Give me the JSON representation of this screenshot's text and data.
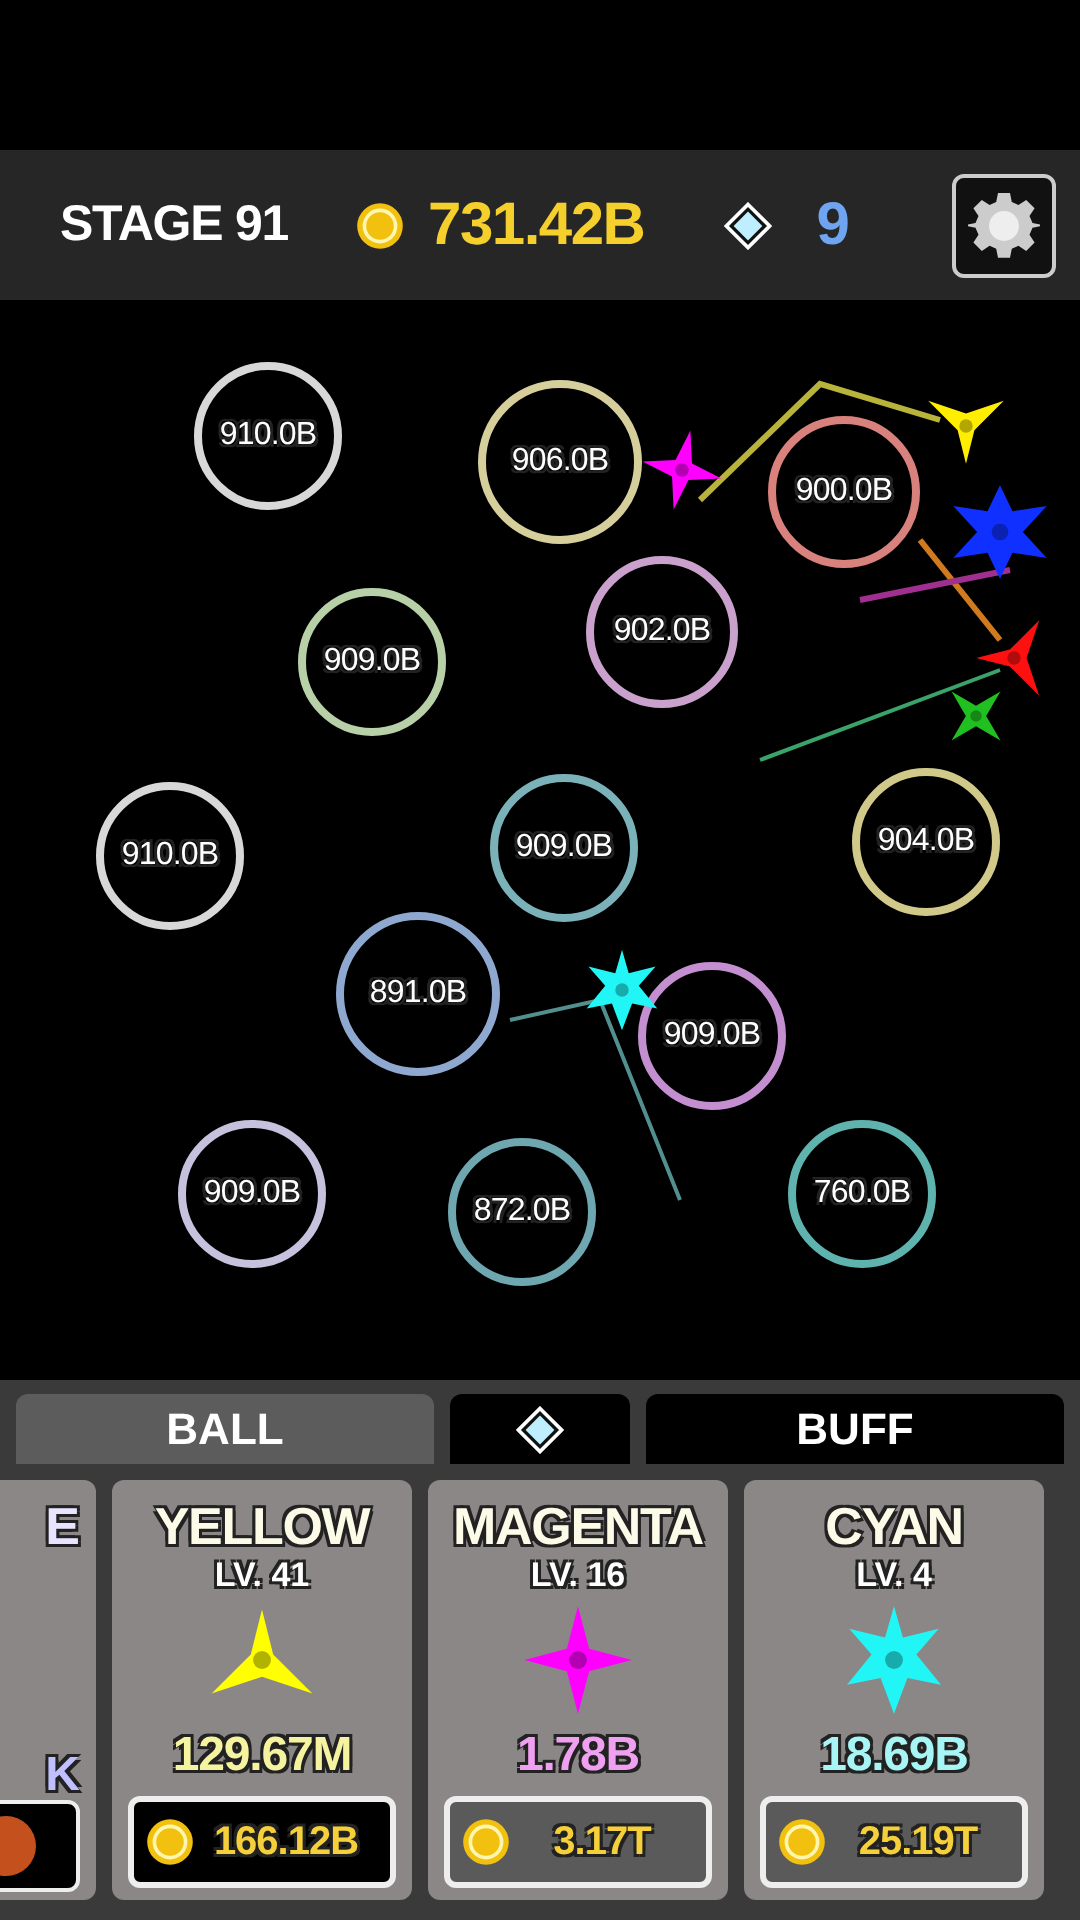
{
  "header": {
    "stage": "STAGE 91",
    "gold": "731.42B",
    "gems": "9"
  },
  "balls": [
    {
      "value": "910.0B",
      "color": "#d8d8d8"
    },
    {
      "value": "906.0B",
      "color": "#d6cf9c"
    },
    {
      "value": "900.0B",
      "color": "#d9817c"
    },
    {
      "value": "909.0B",
      "color": "#b8d0a8"
    },
    {
      "value": "902.0B",
      "color": "#c9a1cc"
    },
    {
      "value": "910.0B",
      "color": "#d8d8d8"
    },
    {
      "value": "909.0B",
      "color": "#7bb1b8"
    },
    {
      "value": "904.0B",
      "color": "#d1c98a"
    },
    {
      "value": "891.0B",
      "color": "#8ea8cf"
    },
    {
      "value": "909.0B",
      "color": "#c48fd0"
    },
    {
      "value": "909.0B",
      "color": "#c6c1dc"
    },
    {
      "value": "872.0B",
      "color": "#6fa7b0"
    },
    {
      "value": "760.0B",
      "color": "#5fb3ae"
    }
  ],
  "tabs": [
    {
      "kind": "text",
      "label": "BALL",
      "selected": true
    },
    {
      "kind": "gem",
      "selected": false
    },
    {
      "kind": "text",
      "label": "BUFF",
      "selected": false
    }
  ],
  "partial_card": {
    "name": "E",
    "damage": "K"
  },
  "cards": [
    {
      "name": "YELLOW",
      "level": "LV. 41",
      "damage": "129.67M",
      "price": "166.12B",
      "affordable": true,
      "color": "#ffff00"
    },
    {
      "name": "MAGENTA",
      "level": "LV. 16",
      "damage": "1.78B",
      "price": "3.17T",
      "affordable": false,
      "color": "#ff00ff"
    },
    {
      "name": "CYAN",
      "level": "LV. 4",
      "damage": "18.69B",
      "price": "25.19T",
      "affordable": false,
      "color": "#22f5f5"
    }
  ]
}
